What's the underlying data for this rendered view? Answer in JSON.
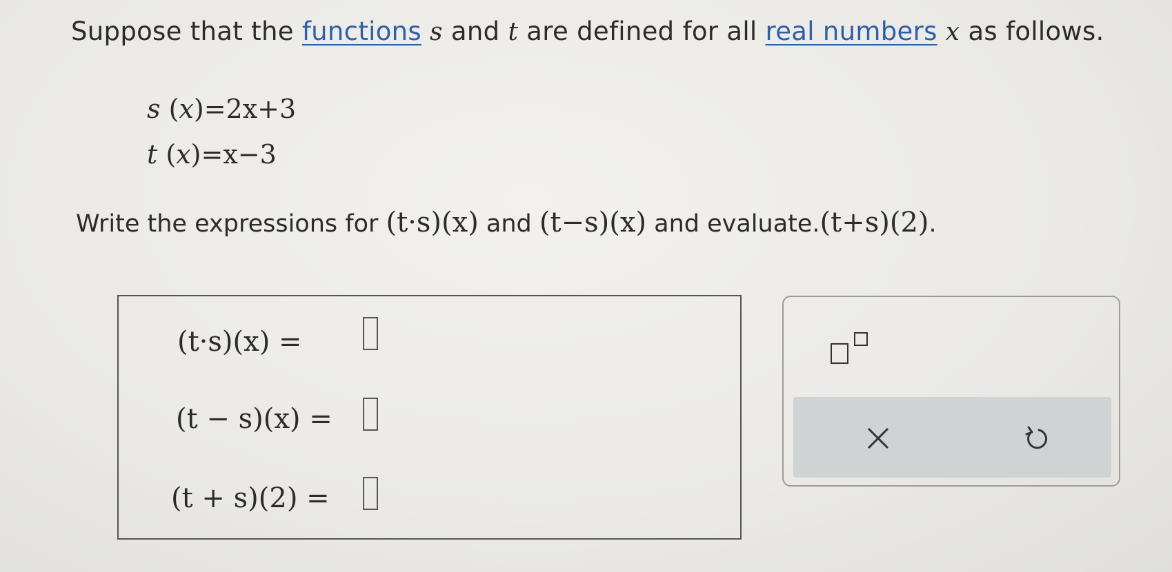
{
  "question": {
    "prefix": "Suppose that the ",
    "link1": "functions",
    "var1": "s",
    "mid1": " and ",
    "var2": "t",
    "mid2": " are defined for all ",
    "link2": "real numbers",
    "var3": "x",
    "suffix": " as follows."
  },
  "definitions": {
    "s_name": "s",
    "s_arg": "x",
    "s_rhs": "2x+3",
    "t_name": "t",
    "t_arg": "x",
    "t_rhs": "x−3"
  },
  "instruction": {
    "prefix": "Write the expressions for ",
    "expr1": "(t·s)(x)",
    "mid": " and ",
    "expr2": "(t−s)(x)",
    "mid2": " and evaluate.",
    "expr3": "(t+s)(2)",
    "suffix": "."
  },
  "answers": [
    {
      "label": "(t·s)(x)",
      "value": ""
    },
    {
      "label": "(t − s)(x)",
      "value": ""
    },
    {
      "label": "(t + s)(2)",
      "value": ""
    }
  ],
  "equals": "=",
  "toolbox": {
    "exponent_icon": "exponent-template-icon",
    "clear_icon": "close-x-icon",
    "reset_icon": "undo-reset-icon"
  }
}
